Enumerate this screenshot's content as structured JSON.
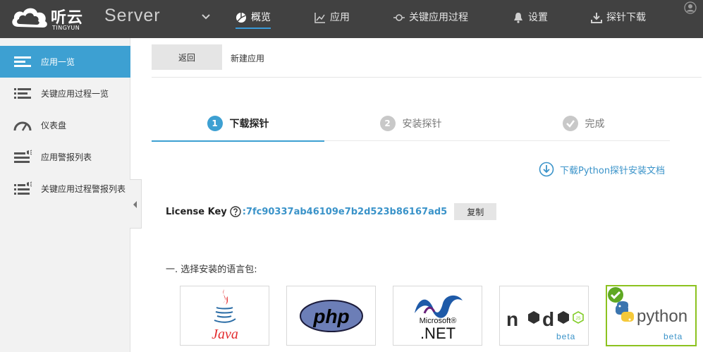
{
  "header": {
    "brand": "听云",
    "brand_sub": "TINGYUN",
    "product": "Server",
    "nav": [
      {
        "label": "概览",
        "icon": "overview-icon",
        "active": true
      },
      {
        "label": "应用",
        "icon": "chart-icon"
      },
      {
        "label": "关键应用过程",
        "icon": "key-transaction-icon"
      },
      {
        "label": "设置",
        "icon": "bell-icon"
      },
      {
        "label": "探针下载",
        "icon": "download-icon"
      }
    ]
  },
  "sidebar": {
    "items": [
      {
        "label": "应用一览",
        "icon": "list-icon",
        "active": true
      },
      {
        "label": "关键应用过程一览",
        "icon": "list-icon"
      },
      {
        "label": "仪表盘",
        "icon": "gauge-icon"
      },
      {
        "label": "应用警报列表",
        "icon": "alert-list-icon"
      },
      {
        "label": "关键应用过程警报列表",
        "icon": "alert-list-icon"
      }
    ]
  },
  "subbar": {
    "back_label": "返回",
    "crumb": "新建应用"
  },
  "steps": [
    {
      "num": "1",
      "label": "下载探针",
      "active": true
    },
    {
      "num": "2",
      "label": "安装探针"
    },
    {
      "num": "",
      "label": "完成"
    }
  ],
  "doc_link": "下载Python探针安装文档",
  "license": {
    "label": "License Key",
    "separator": ":",
    "key": "7fc90337ab46109e7b2d523b86167ad5",
    "copy_label": "复制"
  },
  "lang_section": {
    "title": "一. 选择安装的语言包:",
    "options": [
      {
        "name": "Java",
        "selected": false
      },
      {
        "name": "php",
        "selected": false
      },
      {
        "name": "Microsoft .NET",
        "selected": false
      },
      {
        "name": "node js",
        "badge": "beta",
        "selected": false
      },
      {
        "name": "python",
        "badge": "beta",
        "selected": true
      }
    ]
  },
  "colors": {
    "topbar": "#414141",
    "accent": "#3da0d2",
    "link": "#3a93c9",
    "selected_border": "#8cc21f"
  }
}
